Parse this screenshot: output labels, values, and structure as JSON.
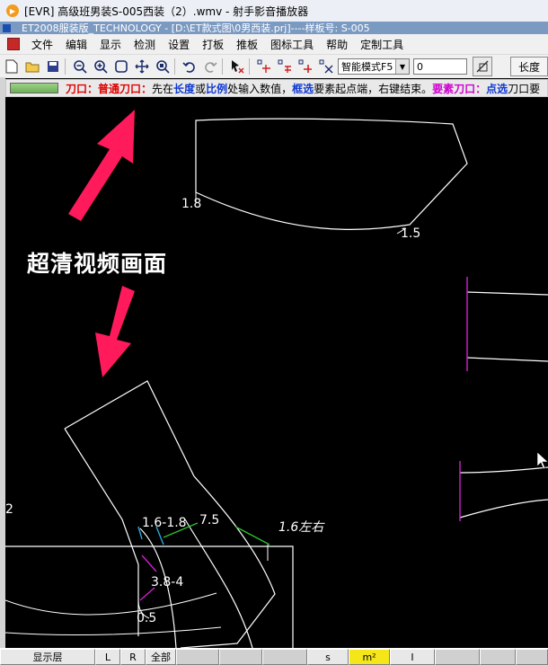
{
  "player": {
    "title": "[EVR] 高级班男装S-005西装（2）.wmv - 射手影音播放器"
  },
  "app": {
    "title": "ET2008服装版_TECHNOLOGY - [D:\\ET款式图\\0男西装.prj]----样板号: S-005"
  },
  "menu": [
    "文件",
    "编辑",
    "显示",
    "检测",
    "设置",
    "打板",
    "推板",
    "图标工具",
    "帮助",
    "定制工具"
  ],
  "toolbar": {
    "mode_select": "智能模式F5",
    "value_input": "0",
    "length_button": "长度"
  },
  "hint": {
    "p1": "刀口：",
    "p2": "普通刀口：",
    "p3": "先在",
    "p4": "长度",
    "p5": "或",
    "p6": "比例",
    "p7": "处输入数值，",
    "p8": "框选",
    "p9": "要素起点端，右键结束。",
    "p10": "要素刀口：",
    "p11": "点选",
    "p12": "刀口要"
  },
  "overlay": {
    "caption": "超清视频画面"
  },
  "annotations": {
    "a1": "1.8",
    "a2": "1.5",
    "a3": "2",
    "a4": "1.6-1.8",
    "a5": "7.5",
    "a6": "1.6左右",
    "a7": "3.8-4",
    "a8": "0.5"
  },
  "statusbar": {
    "layer_button": "显示层",
    "l_button": "L",
    "r_button": "R",
    "all_button": "全部",
    "s_label": "s",
    "m2_label": "m²",
    "i_label": "I"
  },
  "colors": {
    "hint_red": "#e00000",
    "hint_blue": "#1038d0",
    "hint_magenta": "#d000d0",
    "arrow": "#ff1a5c",
    "line": "#ffffff",
    "notch_magenta": "#d020d0",
    "notch_cyan": "#2aa8d8",
    "notch_green": "#2ec02e"
  }
}
